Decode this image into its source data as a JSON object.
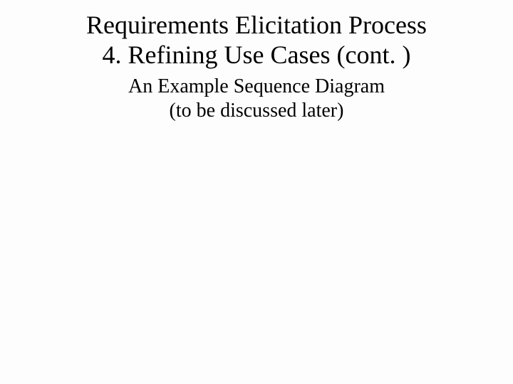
{
  "title_line1": "Requirements Elicitation Process",
  "title_line2": "4. Refining Use Cases (cont. )",
  "subtitle_line1": "An Example Sequence Diagram",
  "subtitle_line2": "(to be discussed later)"
}
